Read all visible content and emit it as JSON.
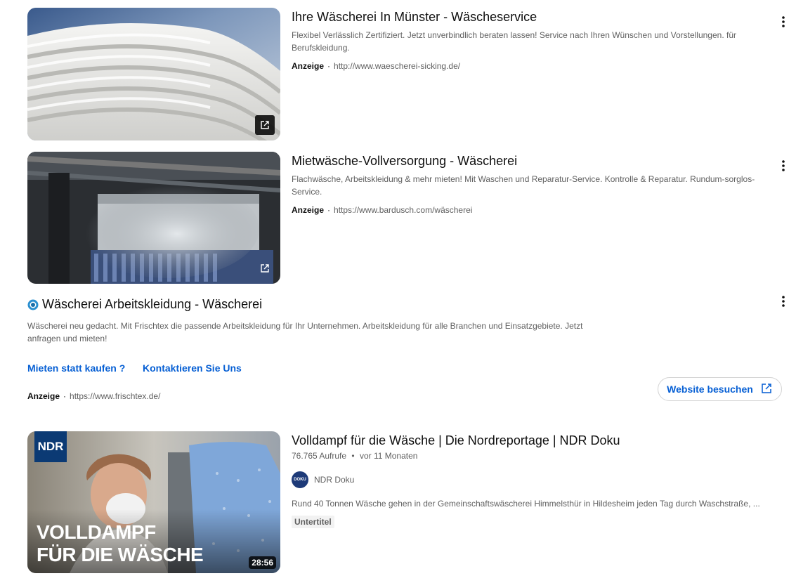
{
  "ads": [
    {
      "title": "Ihre Wäscherei In Münster - Wäscheservice",
      "description": "Flexibel Verlässlich Zertifiziert. Jetzt unverbindlich beraten lassen! Service nach Ihren Wünschen und Vorstellungen. für Berufskleidung.",
      "ad_label": "Anzeige",
      "separator": "·",
      "url": "http://www.waescherei-sicking.de/",
      "thumbnail_icon": "external-link-icon"
    },
    {
      "title": "Mietwäsche-Vollversorgung - Wäscherei",
      "description": "Flachwäsche, Arbeitskleidung & mehr mieten! Mit Waschen und Reparatur-Service. Kontrolle & Reparatur. Rundum-sorglos-Service.",
      "ad_label": "Anzeige",
      "separator": "·",
      "url": "https://www.bardusch.com/wäscherei",
      "thumbnail_icon": "external-link-icon"
    }
  ],
  "text_ad": {
    "title": "Wäscherei Arbeitskleidung - Wäscherei",
    "description": "Wäscherei neu gedacht. Mit Frischtex die passende Arbeitskleidung für Ihr Unternehmen. Arbeitskleidung für alle Branchen und Einsatzgebiete. Jetzt anfragen und mieten!",
    "sitelinks": [
      "Mieten statt kaufen ?",
      "Kontaktieren Sie Uns"
    ],
    "ad_label": "Anzeige",
    "separator": "·",
    "url": "https://www.frischtex.de/",
    "button_label": "Website besuchen",
    "logo_icon": "frischtex-logo-icon"
  },
  "video": {
    "title": "Volldampf für die Wäsche | Die Nordreportage | NDR Doku",
    "views": "76.765 Aufrufe",
    "separator": "•",
    "age": "vor 11 Monaten",
    "channel": "NDR Doku",
    "channel_avatar_text": "DOKU",
    "description": "Rund 40 Tonnen Wäsche gehen in der Gemeinschaftswäscherei Himmelsthür in Hildesheim jeden Tag durch Waschstraße, ...",
    "badge": "Untertitel",
    "duration": "28:56",
    "thumb_logo": "NDR",
    "thumb_line1": "VOLLDAMPF",
    "thumb_line2": "FÜR DIE WÄSCHE"
  },
  "colors": {
    "link_blue": "#065fd4",
    "text_primary": "#0f0f0f",
    "text_secondary": "#606060"
  }
}
